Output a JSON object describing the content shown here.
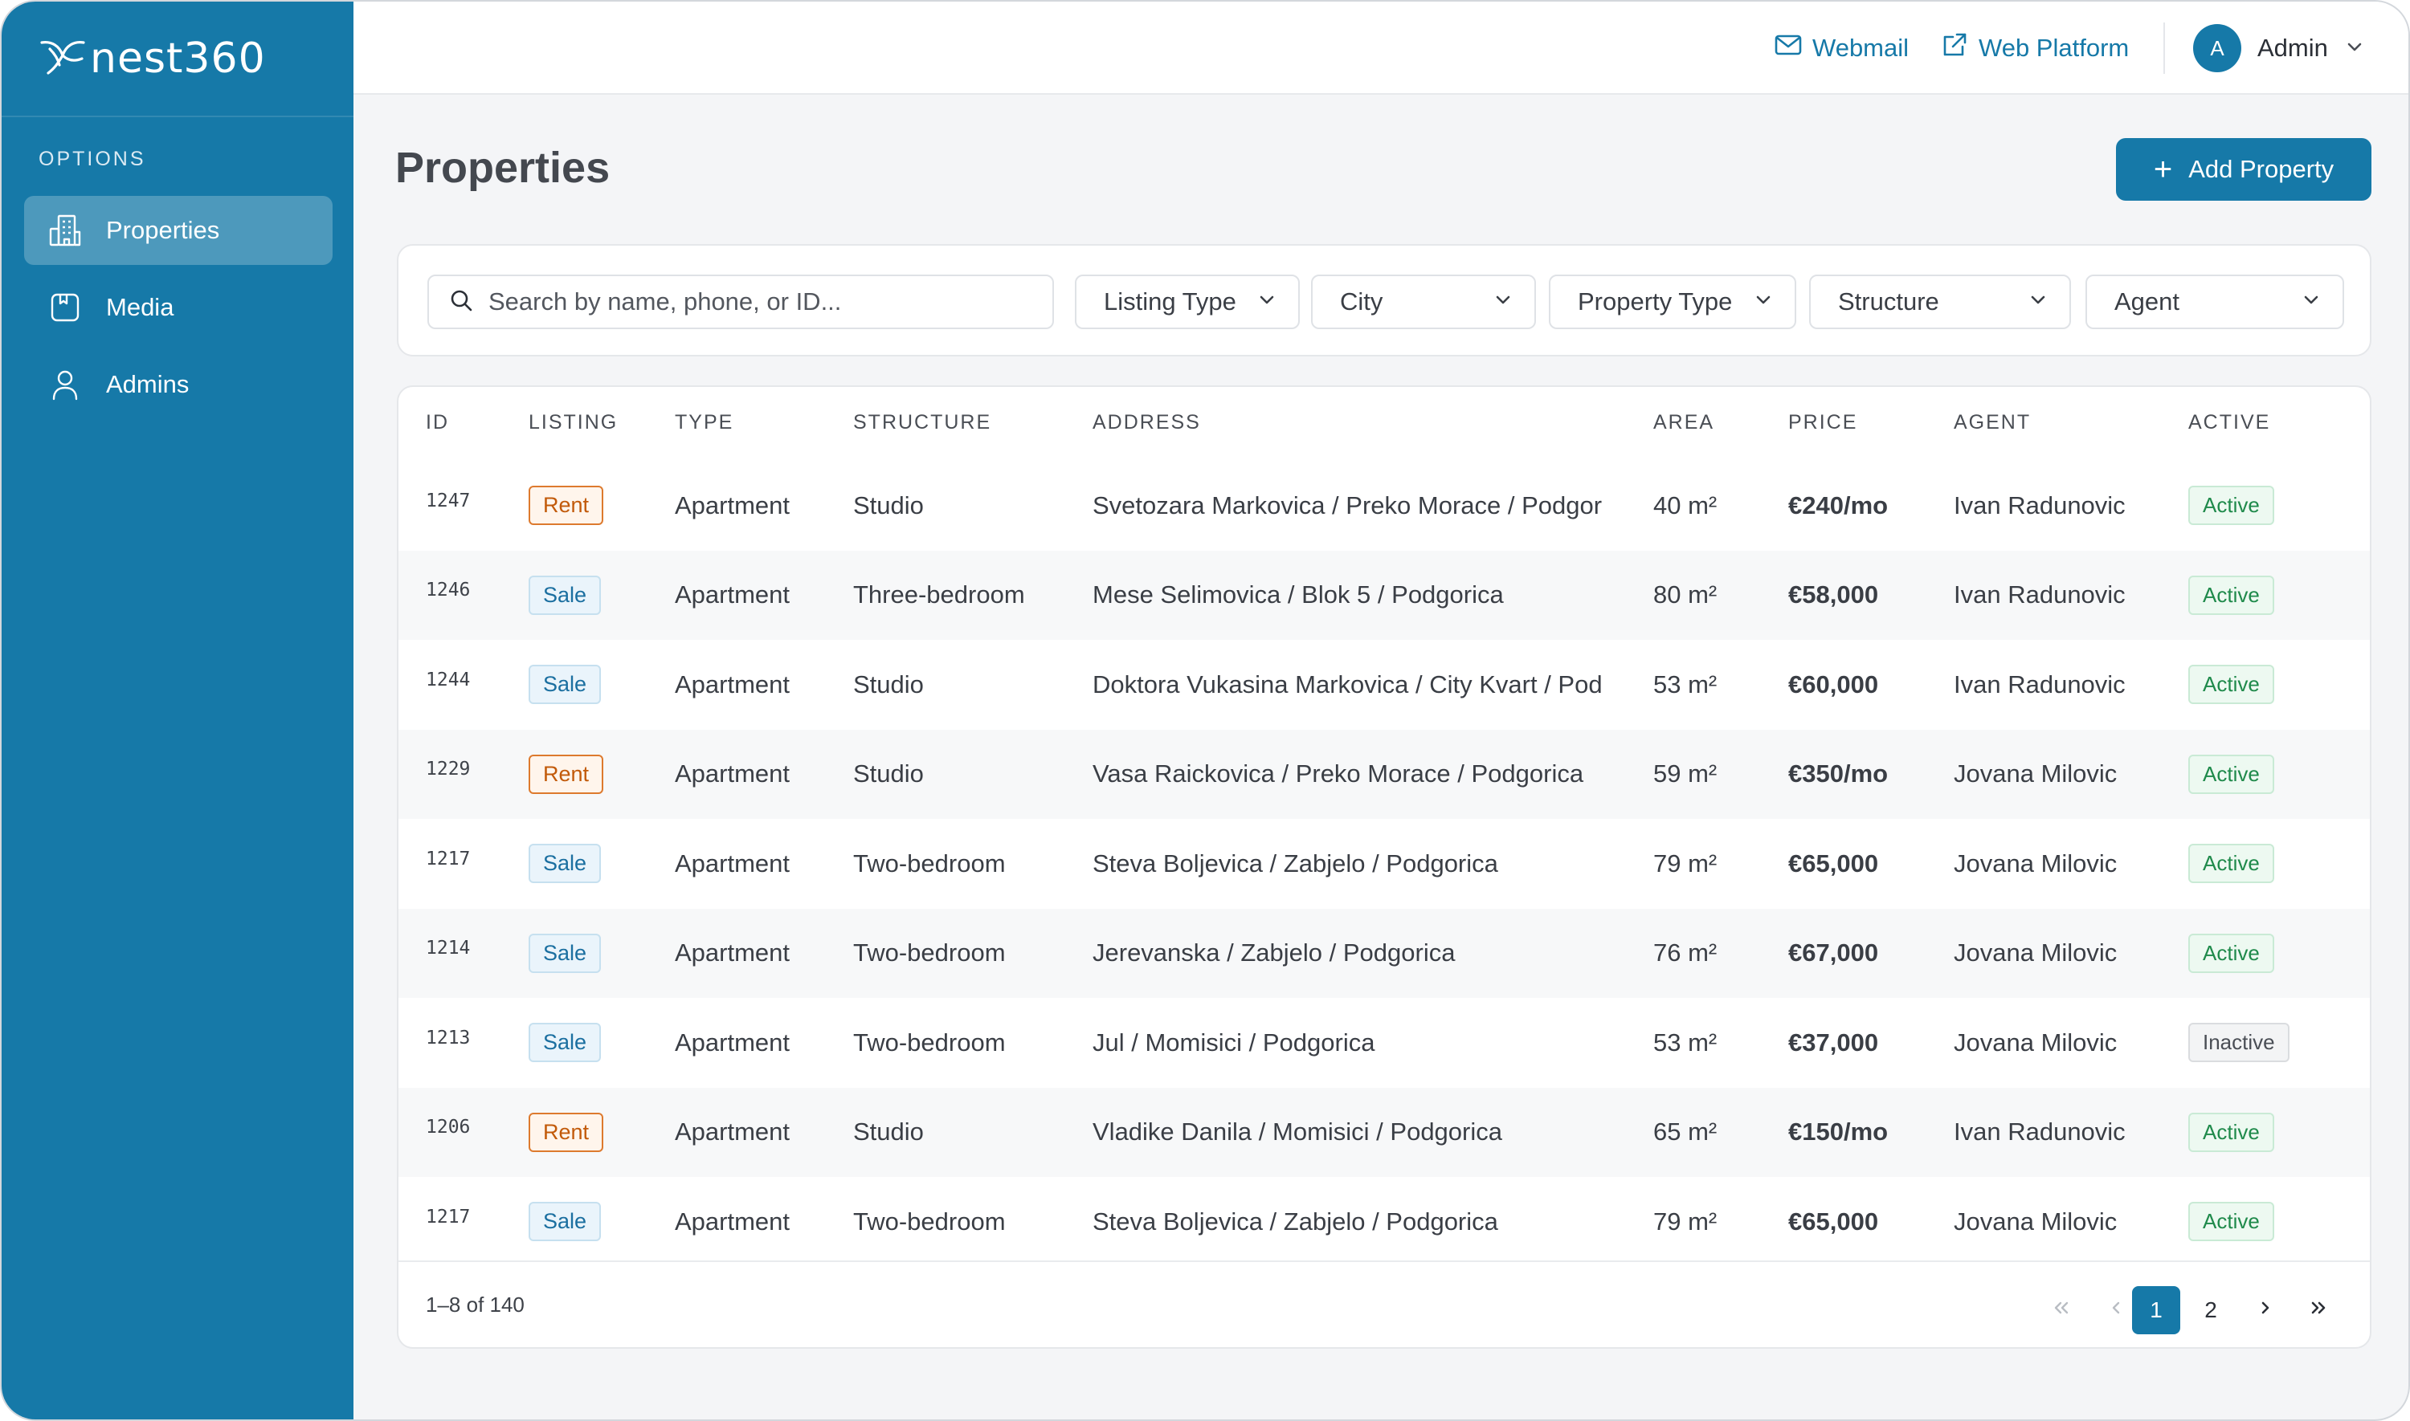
{
  "brand": {
    "name": "nest360",
    "logo_icon": "bird-logo-icon"
  },
  "sidebar": {
    "section_label": "OPTIONS",
    "items": [
      {
        "label": "Properties",
        "icon": "buildings-icon",
        "active": true
      },
      {
        "label": "Media",
        "icon": "media-icon",
        "active": false
      },
      {
        "label": "Admins",
        "icon": "user-icon",
        "active": false
      }
    ]
  },
  "topbar": {
    "webmail_label": "Webmail",
    "web_platform_label": "Web Platform",
    "avatar_initial": "A",
    "user_name": "Admin"
  },
  "page": {
    "title": "Properties",
    "add_button_label": "Add Property"
  },
  "filters": {
    "search_placeholder": "Search by name, phone, or ID...",
    "listing_type": "Listing Type",
    "city": "City",
    "property_type": "Property Type",
    "structure": "Structure",
    "agent": "Agent"
  },
  "table": {
    "columns": [
      "ID",
      "LISTING",
      "TYPE",
      "STRUCTURE",
      "ADDRESS",
      "AREA",
      "PRICE",
      "AGENT",
      "ACTIVE"
    ],
    "rows": [
      {
        "id": "1247",
        "listing": "Rent",
        "type": "Apartment",
        "structure": "Studio",
        "address": "Svetozara Markovica / Preko Morace / Podgor",
        "area": "40 m²",
        "price": "€240/mo",
        "agent": "Ivan Radunovic",
        "status": "Active"
      },
      {
        "id": "1246",
        "listing": "Sale",
        "type": "Apartment",
        "structure": "Three-bedroom",
        "address": "Mese Selimovica / Blok 5 / Podgorica",
        "area": "80 m²",
        "price": "€58,000",
        "agent": "Ivan Radunovic",
        "status": "Active"
      },
      {
        "id": "1244",
        "listing": "Sale",
        "type": "Apartment",
        "structure": "Studio",
        "address": "Doktora Vukasina Markovica / City Kvart / Pod",
        "area": "53 m²",
        "price": "€60,000",
        "agent": "Ivan Radunovic",
        "status": "Active"
      },
      {
        "id": "1229",
        "listing": "Rent",
        "type": "Apartment",
        "structure": "Studio",
        "address": "Vasa Raickovica / Preko Morace / Podgorica",
        "area": "59 m²",
        "price": "€350/mo",
        "agent": "Jovana Milovic",
        "status": "Active"
      },
      {
        "id": "1217",
        "listing": "Sale",
        "type": "Apartment",
        "structure": "Two-bedroom",
        "address": "Steva Boljevica / Zabjelo / Podgorica",
        "area": "79 m²",
        "price": "€65,000",
        "agent": "Jovana Milovic",
        "status": "Active"
      },
      {
        "id": "1214",
        "listing": "Sale",
        "type": "Apartment",
        "structure": "Two-bedroom",
        "address": "Jerevanska / Zabjelo / Podgorica",
        "area": "76 m²",
        "price": "€67,000",
        "agent": "Jovana Milovic",
        "status": "Active"
      },
      {
        "id": "1213",
        "listing": "Sale",
        "type": "Apartment",
        "structure": "Two-bedroom",
        "address": "Jul / Momisici / Podgorica",
        "area": "53 m²",
        "price": "€37,000",
        "agent": "Jovana Milovic",
        "status": "Inactive"
      },
      {
        "id": "1206",
        "listing": "Rent",
        "type": "Apartment",
        "structure": "Studio",
        "address": "Vladike Danila / Momisici / Podgorica",
        "area": "65 m²",
        "price": "€150/mo",
        "agent": "Ivan Radunovic",
        "status": "Active"
      },
      {
        "id": "1217",
        "listing": "Sale",
        "type": "Apartment",
        "structure": "Two-bedroom",
        "address": "Steva Boljevica / Zabjelo / Podgorica",
        "area": "79 m²",
        "price": "€65,000",
        "agent": "Jovana Milovic",
        "status": "Active"
      }
    ]
  },
  "pagination": {
    "range_label": "1–8 of 140",
    "pages": [
      "1",
      "2"
    ],
    "current_page": "1"
  },
  "colors": {
    "brand_blue": "#1679a8",
    "rent_orange": "#c25a0a",
    "active_green": "#1f8a4b"
  }
}
